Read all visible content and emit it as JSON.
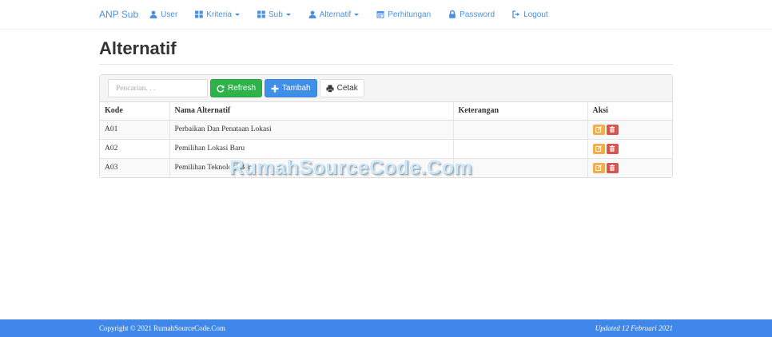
{
  "navbar": {
    "brand": "ANP Sub",
    "items": [
      {
        "label": "User",
        "icon": "user-icon",
        "dropdown": false
      },
      {
        "label": "Kriteria",
        "icon": "th-large-icon",
        "dropdown": true
      },
      {
        "label": "Sub",
        "icon": "th-large-icon",
        "dropdown": true
      },
      {
        "label": "Alternatif",
        "icon": "user-icon",
        "dropdown": true
      },
      {
        "label": "Perhitungan",
        "icon": "calendar-icon",
        "dropdown": false
      },
      {
        "label": "Password",
        "icon": "lock-icon",
        "dropdown": false
      },
      {
        "label": "Logout",
        "icon": "logout-icon",
        "dropdown": false
      }
    ],
    "link_color": "#4a90e2"
  },
  "page": {
    "title": "Alternatif"
  },
  "toolbar": {
    "search_placeholder": "Pencarian. . .",
    "refresh_label": "Refresh",
    "add_label": "Tambah",
    "print_label": "Cetak"
  },
  "table": {
    "headers": [
      "Kode",
      "Nama Alternatif",
      "Keterangan",
      "Aksi"
    ],
    "rows": [
      {
        "kode": "A01",
        "nama": "Perbaikan Dan Penataan Lokasi",
        "keterangan": ""
      },
      {
        "kode": "A02",
        "nama": "Pemilihan Lokasi Baru",
        "keterangan": ""
      },
      {
        "kode": "A03",
        "nama": "Pemilihan Teknologi Baru",
        "keterangan": ""
      }
    ]
  },
  "watermark": "RumahSourceCode.Com",
  "footer": {
    "copyright": "Copyright © 2021 RumahSourceCode.Com",
    "updated": "Updated 12 Februari 2021",
    "color": "#3f87e8"
  }
}
